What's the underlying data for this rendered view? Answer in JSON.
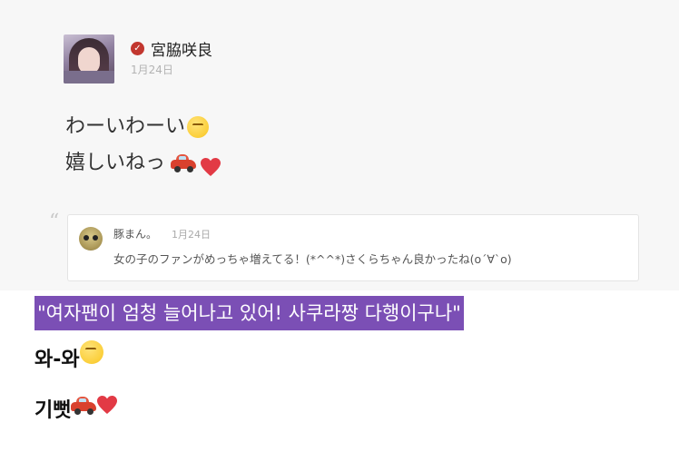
{
  "post": {
    "author": "宮脇咲良",
    "date": "1月24日",
    "verified_icon": "check-circle-icon",
    "lines": [
      "わーいわーい",
      "嬉しいねっ"
    ]
  },
  "quote": {
    "mark": "“",
    "author": "豚まん。",
    "date": "1月24日",
    "text": "女の子のファンがめっちゃ増えてる！(*^^*)さくらちゃん良かったね(o´∀`o)"
  },
  "translation": {
    "text": "\"여자팬이 엄청 늘어나고 있어! 사쿠라짱 다행이구나\"",
    "highlight_color": "#7b4fb5"
  },
  "korean": {
    "line1": "와-와",
    "line2": "기뻣"
  },
  "colors": {
    "verified": "#c2372f",
    "date_gray": "#b3b3b3"
  }
}
